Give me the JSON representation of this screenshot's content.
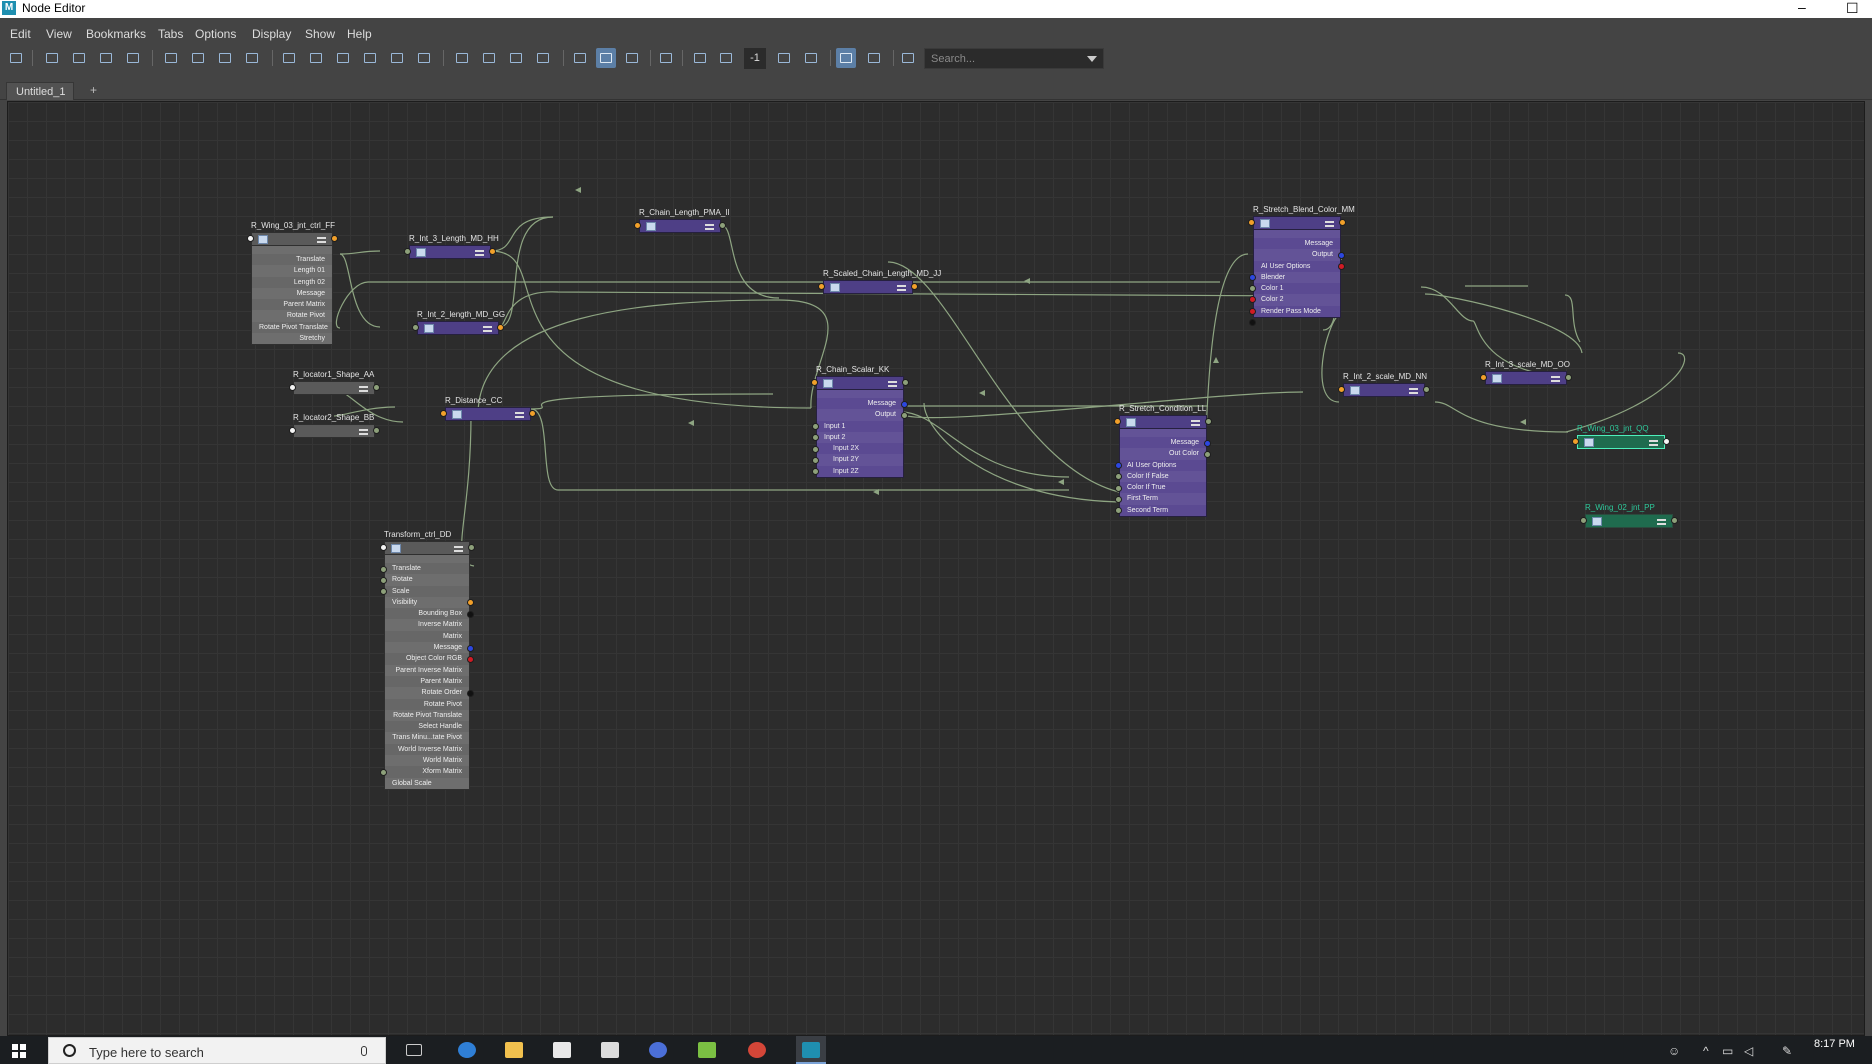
{
  "window": {
    "title": "Node Editor",
    "icon": "maya-icon"
  },
  "menu": [
    "Edit",
    "View",
    "Bookmarks",
    "Tabs",
    "Options",
    "Display",
    "Show",
    "Help"
  ],
  "toolbar": {
    "zoom_value": "-1",
    "search_placeholder": "Search..."
  },
  "tabs": {
    "active": "Untitled_1",
    "add": "+"
  },
  "nodes": {
    "n_ff": {
      "title": "R_Wing_03_jnt_ctrl_FF",
      "attrs": [
        "Translate",
        "Length 01",
        "Length 02",
        "Message",
        "Parent Matrix",
        "Rotate Pivot",
        "Rotate Pivot Translate",
        "Stretchy"
      ]
    },
    "n_hh": {
      "title": "R_Int_3_Length_MD_HH"
    },
    "n_gg": {
      "title": "R_Int_2_length_MD_GG"
    },
    "n_ii": {
      "title": "R_Chain_Length_PMA_II"
    },
    "n_jj": {
      "title": "R_Scaled_Chain_Length_MD_JJ"
    },
    "n_mm": {
      "title": "R_Stretch_Blend_Color_MM",
      "attrs": [
        "Message",
        "Output",
        "AI User Options",
        "Blender",
        "Color 1",
        "Color 2",
        "Render Pass Mode"
      ]
    },
    "n_oo": {
      "title": "R_Int_3_scale_MD_OO"
    },
    "n_qq": {
      "title": "R_Wing_03_jnt_QQ"
    },
    "n_pp": {
      "title": "R_Wing_02_jnt_PP"
    },
    "n_aa": {
      "title": "R_locator1_Shape_AA"
    },
    "n_bb": {
      "title": "R_locator2_Shape_BB"
    },
    "n_cc": {
      "title": "R_Distance_CC"
    },
    "n_kk": {
      "title": "R_Chain_Scalar_KK",
      "attrs": [
        "Message",
        "Output",
        "Input 1",
        "Input 2",
        "Input 2X",
        "Input 2Y",
        "Input 2Z"
      ]
    },
    "n_nn": {
      "title": "R_Int_2_scale_MD_NN"
    },
    "n_ll": {
      "title": "R_Stretch_Condition_LL",
      "attrs": [
        "Message",
        "Out Color",
        "AI User Options",
        "Color If False",
        "Color If True",
        "First Term",
        "Second Term"
      ]
    },
    "n_dd": {
      "title": "Transform_ctrl_DD",
      "attrs": [
        "Translate",
        "Rotate",
        "Scale",
        "Visibility",
        "Bounding Box",
        "Inverse Matrix",
        "Matrix",
        "Message",
        "Object Color RGB",
        "Parent Inverse Matrix",
        "Parent Matrix",
        "Rotate Order",
        "Rotate Pivot",
        "Rotate Pivot Translate",
        "Select Handle",
        "Trans Minu...tate Pivot",
        "World Inverse Matrix",
        "World Matrix",
        "Xform Matrix",
        "Global Scale"
      ]
    }
  },
  "taskbar": {
    "search_placeholder": "Type here to search",
    "time": "8:17 PM"
  }
}
